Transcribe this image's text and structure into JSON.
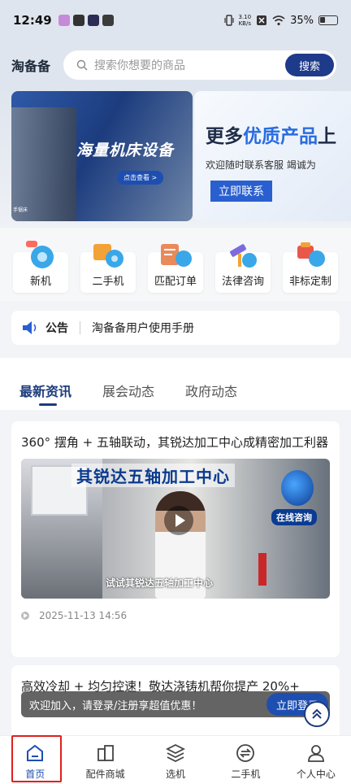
{
  "status_bar": {
    "time": "12:49",
    "net_speed_value": "3.10",
    "net_speed_unit": "KB/s",
    "battery": "35%",
    "apps": [
      "#c68bd8",
      "#333333",
      "#2c2c54",
      "#3b3b3b"
    ]
  },
  "header": {
    "brand": "淘备备",
    "search_placeholder": "搜索你想要的商品",
    "search_button": "搜索"
  },
  "banners": {
    "left": {
      "title": "海量机床设备",
      "cta": "点击查看 >",
      "small": "手锯床"
    },
    "right": {
      "headline_prefix": "更多",
      "headline_highlight": "优质产品",
      "headline_suffix": "上",
      "subtitle": "欢迎随时联系客服  竭诚为",
      "button": "立即联系"
    }
  },
  "categories": [
    {
      "label": "新机",
      "icon": "new-machine-icon",
      "color": "#3aa7e8"
    },
    {
      "label": "二手机",
      "icon": "used-machine-icon",
      "color": "#f2a236"
    },
    {
      "label": "匹配订单",
      "icon": "match-order-icon",
      "color": "#e98a5a"
    },
    {
      "label": "法律咨询",
      "icon": "legal-consult-icon",
      "color": "#7c6be0"
    },
    {
      "label": "非标定制",
      "icon": "custom-icon",
      "color": "#e9574a"
    }
  ],
  "notice": {
    "label": "公告",
    "text": "淘备备用户使用手册"
  },
  "tabs": [
    {
      "label": "最新资讯",
      "active": true
    },
    {
      "label": "展会动态",
      "active": false
    },
    {
      "label": "政府动态",
      "active": false
    }
  ],
  "news": [
    {
      "title": "360° 摆角 + 五轴联动，其锐达加工中心成精密加工利器",
      "video_title": "其锐达五轴加工中心",
      "video_badge": "在线咨询",
      "video_caption": "试试其锐达五轴加工中心",
      "date": "2025-11-13 14:56"
    },
    {
      "title": "高效冷却 + 均匀控速！敬达浇铸机帮你提产 20%+"
    }
  ],
  "login_bar": {
    "text": "欢迎加入，请登录/注册享超值优惠！",
    "button": "立即登录"
  },
  "bottom_nav": [
    {
      "label": "首页",
      "icon": "home-icon",
      "active": true
    },
    {
      "label": "配件商城",
      "icon": "parts-mall-icon",
      "active": false
    },
    {
      "label": "选机",
      "icon": "select-machine-icon",
      "active": false
    },
    {
      "label": "二手机",
      "icon": "used-machine-nav-icon",
      "active": false
    },
    {
      "label": "个人中心",
      "icon": "profile-icon",
      "active": false
    }
  ],
  "colors": {
    "primary": "#1e3a8a",
    "highlight": "#e0201c"
  }
}
